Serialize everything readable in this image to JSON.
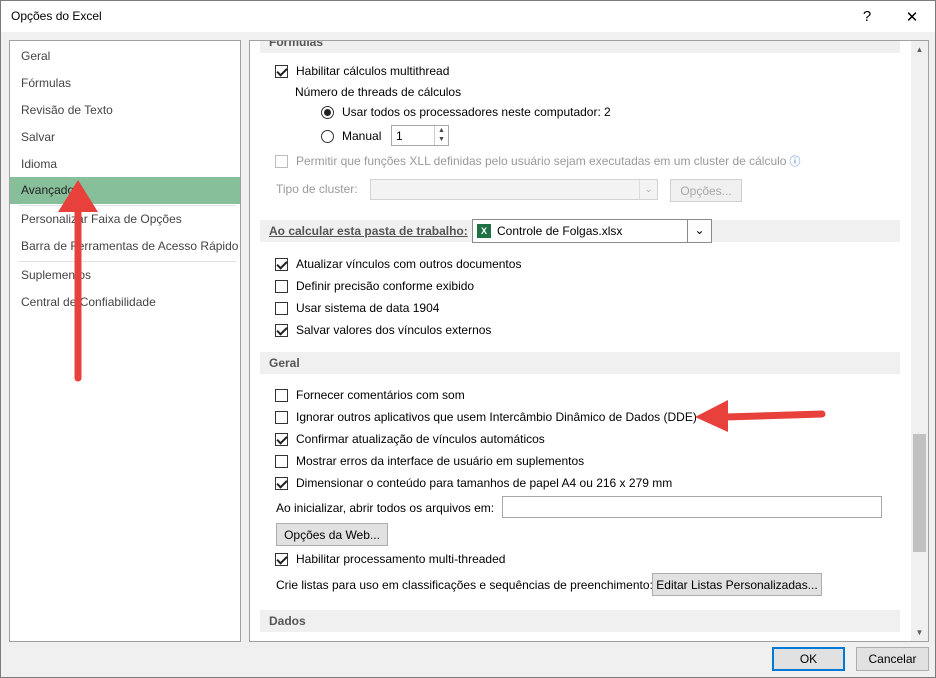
{
  "window": {
    "title": "Opções do Excel",
    "help_glyph": "?",
    "close_glyph": "✕",
    "ok": "OK",
    "cancel": "Cancelar"
  },
  "nav": {
    "items": [
      "Geral",
      "Fórmulas",
      "Revisão de Texto",
      "Salvar",
      "Idioma",
      "Avançado",
      "Personalizar Faixa de Opções",
      "Barra de Ferramentas de Acesso Rápido",
      "Suplementos",
      "Central de Confiabilidade"
    ],
    "selected_index": 5
  },
  "formulas": {
    "header": "Fórmulas",
    "multithread": {
      "label": "Habilitar cálculos multithread",
      "checked": true
    },
    "threads_label": "Número de threads de cálculos",
    "use_all": {
      "label": "Usar todos os processadores neste computador:",
      "value": "2",
      "selected": true
    },
    "manual": {
      "label": "Manual",
      "value": "1",
      "selected": false
    },
    "xll": {
      "label": "Permitir que funções XLL definidas pelo usuário sejam executadas em um cluster de cálculo",
      "checked": false,
      "info_glyph": "ⓘ"
    },
    "cluster_type_label": "Tipo de cluster:",
    "cluster_options_button": "Opções..."
  },
  "workbook": {
    "header": "Ao calcular esta pasta de trabalho:",
    "file": "Controle de Folgas.xlsx",
    "file_icon_letter": "X",
    "options": [
      {
        "label": "Atualizar vínculos com outros documentos",
        "checked": true
      },
      {
        "label": "Definir precisão conforme exibido",
        "checked": false
      },
      {
        "label": "Usar sistema de data 1904",
        "checked": false
      },
      {
        "label": "Salvar valores dos vínculos externos",
        "checked": true
      }
    ]
  },
  "general": {
    "header": "Geral",
    "options": [
      {
        "label": "Fornecer comentários com som",
        "checked": false
      },
      {
        "label": "Ignorar outros aplicativos que usem Intercâmbio Dinâmico de Dados (DDE)",
        "checked": false
      },
      {
        "label": "Confirmar atualização de vínculos automáticos",
        "checked": true
      },
      {
        "label": "Mostrar erros da interface de usuário em suplementos",
        "checked": false
      },
      {
        "label": "Dimensionar o conteúdo para tamanhos de papel A4 ou 216 x 279 mm",
        "checked": true
      }
    ],
    "startup_label": "Ao inicializar, abrir todos os arquivos em:",
    "startup_value": "",
    "web_options_button": "Opções da Web...",
    "multithreaded": {
      "label": "Habilitar processamento multi-threaded",
      "checked": true
    },
    "lists_label": "Crie listas para uso em classificações e sequências de preenchimento:",
    "edit_lists_button": "Editar Listas Personalizadas..."
  },
  "data_section": {
    "header": "Dados"
  },
  "annotation": {
    "color": "#e8413c"
  }
}
